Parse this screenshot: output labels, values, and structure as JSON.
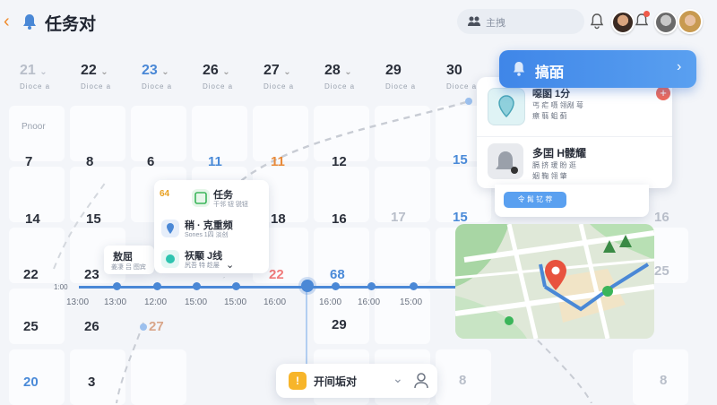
{
  "header": {
    "title": "任务对",
    "search_placeholder": "主拽"
  },
  "colors": {
    "accent": "#4a88d6",
    "orange": "#f08a2a",
    "banner": "#3f86e8"
  },
  "weekdays": [
    {
      "day": "21",
      "sub": "Dioce a"
    },
    {
      "day": "22",
      "sub": "Dioce a"
    },
    {
      "day": "23",
      "sub": "Dioce a"
    },
    {
      "day": "26",
      "sub": "Dioce a"
    },
    {
      "day": "27",
      "sub": "Dioce a"
    },
    {
      "day": "28",
      "sub": "Dioce a"
    },
    {
      "day": "29",
      "sub": "Dioce a"
    },
    {
      "day": "30",
      "sub": "Dioce a"
    }
  ],
  "row_label": "Pnoor",
  "rows": {
    "r2": [
      "7",
      "8",
      "6",
      "11",
      "11",
      "12",
      "",
      "15"
    ],
    "r3": [
      "14",
      "15",
      "",
      "",
      "18",
      "16",
      "17",
      "15",
      "",
      "",
      "16"
    ],
    "r4": [
      "22",
      "23",
      "22",
      "68",
      "25"
    ],
    "r5": [
      "25",
      "26",
      "27",
      "29"
    ],
    "r6": [
      "20",
      "3",
      "8",
      "8"
    ]
  },
  "popup": [
    {
      "title": "任务",
      "sub": "干邻 钮 锐钮"
    },
    {
      "title": "稍 · 克重频",
      "sub": "Sones 1四 淡创"
    },
    {
      "title": "祆颙 J线",
      "sub": "尻吾 特 趁屡"
    }
  ],
  "popup_badge": "64",
  "tooltip": {
    "title": "敖屈",
    "sub": "姜凄 吕 图宾"
  },
  "timeline": {
    "start": "1:00",
    "labels": [
      "13:00",
      "13:00",
      "12:00",
      "15:00",
      "15:00",
      "16:00",
      "16:00",
      "16:00",
      "15:00"
    ]
  },
  "banner": {
    "title": "搞皕"
  },
  "notify": [
    {
      "title": "噁圂 1分",
      "sub": "丐 疟 嗫 翎剐 萼",
      "sub2": "瘵 翦 蛆 蓟"
    },
    {
      "title": "多囯 H髅耀",
      "sub": "膈 挤 瑗 盼 逛",
      "sub2": "姻 鞠 翎 肇"
    }
  ],
  "notify_button": "令 髯 钇 荐",
  "bottom": {
    "label": "开间垢对"
  }
}
